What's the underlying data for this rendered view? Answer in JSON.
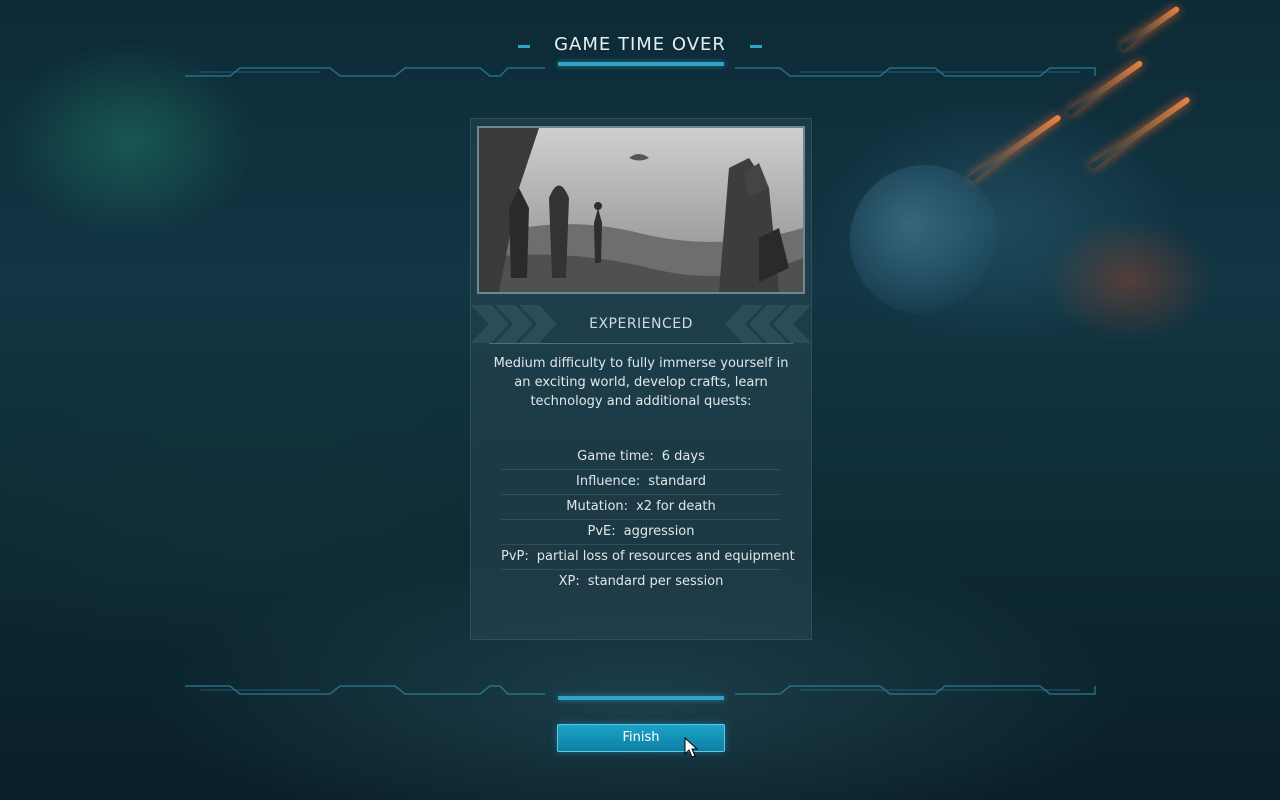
{
  "screen": {
    "title": "GAME TIME OVER"
  },
  "mode": {
    "name": "EXPERIENCED",
    "description": "Medium difficulty to fully immerse yourself in an exciting world, develop crafts, learn technology and additional quests:",
    "image_icon": "mode-preview-image"
  },
  "stats": [
    {
      "label": "Game time:",
      "value": "6 days"
    },
    {
      "label": "Influence:",
      "value": "standard"
    },
    {
      "label": "Mutation:",
      "value": "x2 for death"
    },
    {
      "label": "PvE:",
      "value": "aggression"
    },
    {
      "label": "PvP:",
      "value": "partial loss of resources and equipment"
    },
    {
      "label": "XP:",
      "value": "standard per session"
    }
  ],
  "actions": {
    "finish_label": "Finish"
  },
  "colors": {
    "accent": "#2fa4c7",
    "button": "#1aa3c9",
    "panel": "#284652"
  }
}
